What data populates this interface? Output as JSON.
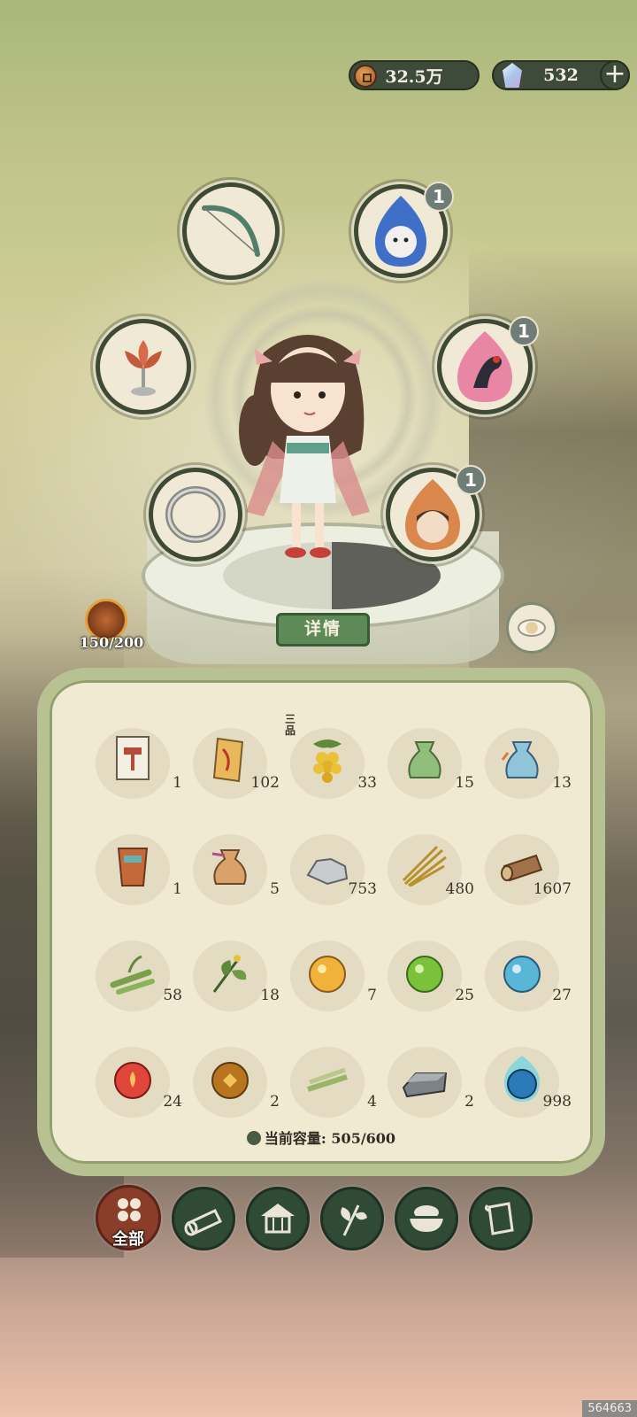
{
  "currency": {
    "coins": "32.5万",
    "gems": "532",
    "plus_label": "+"
  },
  "equipment": {
    "slots": [
      {
        "name": "bow",
        "icon": "bow-icon"
      },
      {
        "name": "spirit-blue",
        "icon": "blue-spirit-icon",
        "badge": "1"
      },
      {
        "name": "lotus",
        "icon": "lotus-icon"
      },
      {
        "name": "spirit-crane",
        "icon": "crane-spirit-icon",
        "badge": "1"
      },
      {
        "name": "ring",
        "icon": "ring-icon"
      },
      {
        "name": "spirit-warrior",
        "icon": "warrior-spirit-icon",
        "badge": "1"
      }
    ]
  },
  "character": {
    "detail_label": "详情"
  },
  "stamina": {
    "value": "150/200"
  },
  "inventory": {
    "items": [
      {
        "icon": "hammer-card-icon",
        "count": "1"
      },
      {
        "icon": "scroll-icon",
        "count": "102"
      },
      {
        "icon": "yellow-berries-icon",
        "count": "33",
        "grade": "三品"
      },
      {
        "icon": "green-pouch-icon",
        "count": "15"
      },
      {
        "icon": "blue-pouch-icon",
        "count": "13"
      },
      {
        "icon": "mask-token-icon",
        "count": "1"
      },
      {
        "icon": "brown-pouch-icon",
        "count": "5"
      },
      {
        "icon": "stone-icon",
        "count": "753"
      },
      {
        "icon": "straw-icon",
        "count": "480"
      },
      {
        "icon": "log-icon",
        "count": "1607"
      },
      {
        "icon": "bamboo-icon",
        "count": "58"
      },
      {
        "icon": "herb-icon",
        "count": "18"
      },
      {
        "icon": "yellow-orb-icon",
        "count": "7"
      },
      {
        "icon": "green-orb-icon",
        "count": "25"
      },
      {
        "icon": "blue-orb-icon",
        "count": "27"
      },
      {
        "icon": "fire-orb-icon",
        "count": "24"
      },
      {
        "icon": "earth-orb-icon",
        "count": "2"
      },
      {
        "icon": "bamboo-strips-icon",
        "count": "4"
      },
      {
        "icon": "iron-ingot-icon",
        "count": "2"
      },
      {
        "icon": "blue-flame-orb-icon",
        "count": "998"
      }
    ],
    "capacity_label": "当前容量:",
    "capacity_value": "505/600"
  },
  "tabs": [
    {
      "name": "all",
      "label": "全部",
      "active": true
    },
    {
      "name": "wood",
      "icon": "log-tab-icon"
    },
    {
      "name": "building",
      "icon": "house-tab-icon"
    },
    {
      "name": "herb",
      "icon": "leaf-tab-icon"
    },
    {
      "name": "food",
      "icon": "bowl-tab-icon"
    },
    {
      "name": "scroll",
      "icon": "scroll-tab-icon"
    }
  ],
  "watermark": "564663",
  "colors": {
    "panel_border": "#b7c192",
    "panel_fill": "#f0ead3",
    "tab_bg": "#2f4a35",
    "tab_active": "#8a3e2a",
    "badge": "#6f7d76",
    "detail_button": "#5e8a58"
  }
}
